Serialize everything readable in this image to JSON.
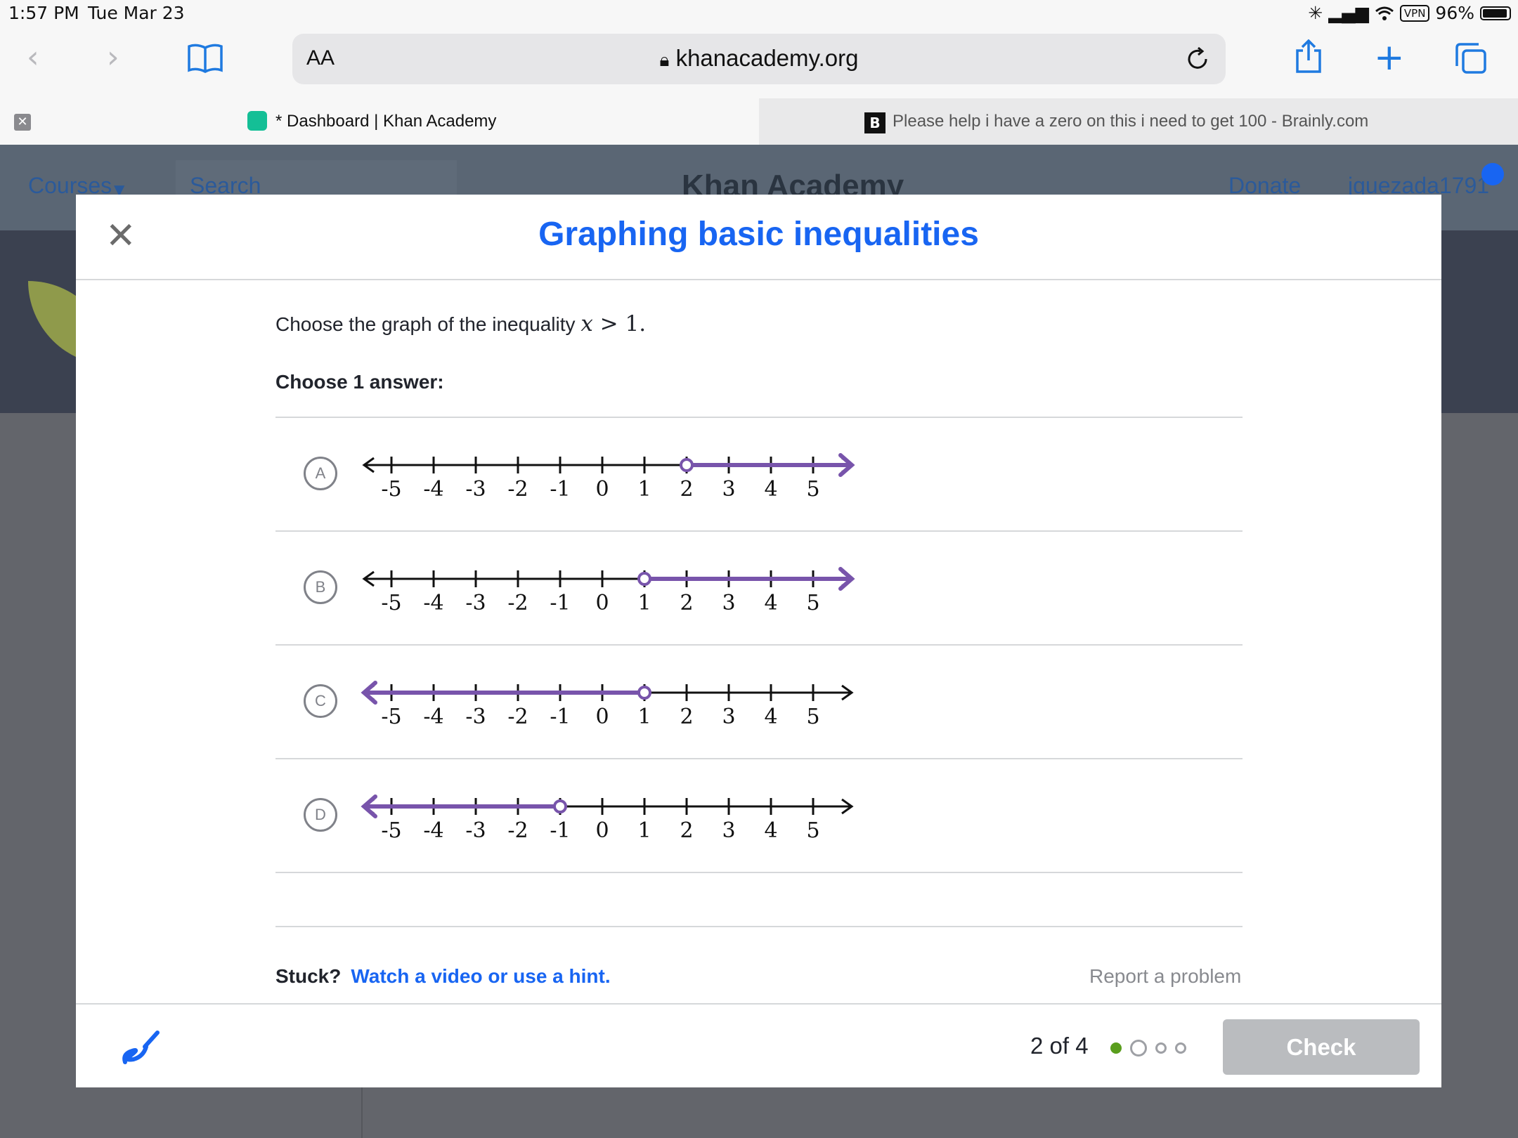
{
  "status_bar": {
    "time": "1:57 PM",
    "date": "Tue Mar 23",
    "vpn": "VPN",
    "battery": "96%"
  },
  "browser": {
    "text_size_label": "AA",
    "url": "khanacademy.org",
    "tabs": [
      {
        "title": "* Dashboard | Khan Academy",
        "active": true
      },
      {
        "title": "Please help i have a zero on this i need to get 100 - Brainly.com",
        "active": false
      }
    ]
  },
  "background_site": {
    "courses": "Courses",
    "search": "Search",
    "brand": "Khan Academy",
    "donate": "Donate",
    "username": "jquezada1791"
  },
  "exercise": {
    "title": "Graphing basic inequalities",
    "question_prefix": "Choose the graph of the inequality ",
    "question_var": "x",
    "question_op": " > ",
    "question_num": "1",
    "question_suffix": ".",
    "choose_label": "Choose 1 answer:",
    "ticks": [
      "-5",
      "-4",
      "-3",
      "-2",
      "-1",
      "0",
      "1",
      "2",
      "3",
      "4",
      "5"
    ],
    "options": [
      {
        "letter": "A",
        "point": 2,
        "direction": "right",
        "open": true
      },
      {
        "letter": "B",
        "point": 1,
        "direction": "right",
        "open": true
      },
      {
        "letter": "C",
        "point": 1,
        "direction": "left",
        "open": true
      },
      {
        "letter": "D",
        "point": -1,
        "direction": "left",
        "open": true
      }
    ],
    "stuck_label": "Stuck?",
    "hint_link": "Watch a video or use a hint.",
    "report_link": "Report a problem",
    "progress_text": "2 of 4",
    "progress_dots": [
      "complete",
      "current",
      "pending",
      "pending"
    ],
    "check_label": "Check",
    "colors": {
      "accent": "#1865f2",
      "graph": "#7854ab",
      "complete": "#5a9e1d",
      "disabled": "#babcbf"
    }
  }
}
